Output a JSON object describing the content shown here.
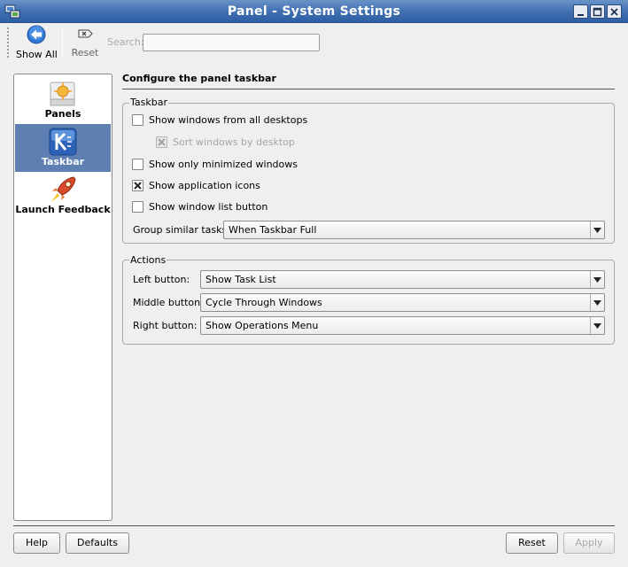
{
  "window": {
    "title": "Panel - System Settings",
    "minimize_icon": "minimize-icon",
    "maximize_icon": "maximize-icon",
    "close_icon": "close-icon"
  },
  "toolbar": {
    "show_all_label": "Show All",
    "reset_label": "Reset",
    "search_label": "Search:",
    "search_value": ""
  },
  "sidebar": {
    "items": [
      {
        "label": "Panels",
        "icon": "panels-icon",
        "selected": false
      },
      {
        "label": "Taskbar",
        "icon": "kde-logo-icon",
        "selected": true
      },
      {
        "label": "Launch Feedback",
        "icon": "rocket-icon",
        "selected": false
      }
    ]
  },
  "main": {
    "heading": "Configure the panel taskbar",
    "taskbar_group": {
      "title": "Taskbar",
      "options": [
        {
          "label": "Show windows from all desktops",
          "checked": false,
          "enabled": true
        },
        {
          "label": "Sort windows by desktop",
          "checked": true,
          "enabled": false
        },
        {
          "label": "Show only minimized windows",
          "checked": false,
          "enabled": true
        },
        {
          "label": "Show application icons",
          "checked": true,
          "enabled": true
        },
        {
          "label": "Show window list button",
          "checked": false,
          "enabled": true
        }
      ],
      "group_similar_label": "Group similar tasks:",
      "group_similar_value": "When Taskbar Full"
    },
    "actions_group": {
      "title": "Actions",
      "left_label": "Left button:",
      "left_value": "Show Task List",
      "middle_label": "Middle button:",
      "middle_value": "Cycle Through Windows",
      "right_label": "Right button:",
      "right_value": "Show Operations Menu"
    }
  },
  "buttons": {
    "help": "Help",
    "defaults": "Defaults",
    "reset": "Reset",
    "apply": "Apply"
  },
  "colors": {
    "titlebar": "#3e6eb0",
    "selection": "#5d7fb2"
  }
}
